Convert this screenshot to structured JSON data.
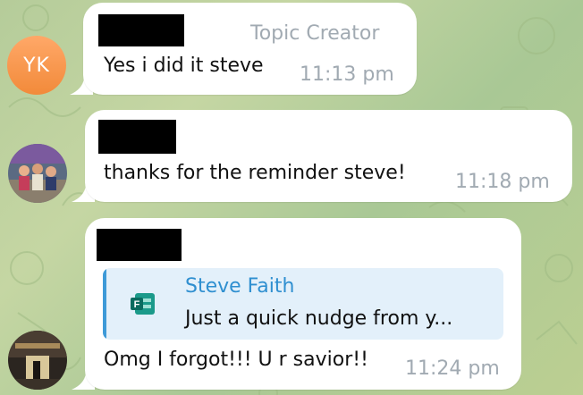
{
  "messages": [
    {
      "sender_badge": "Topic Creator",
      "text": "Yes i did it steve",
      "time": "11:13 pm",
      "avatar_initials": "YK"
    },
    {
      "text": "thanks for the reminder steve!",
      "time": "11:18 pm",
      "avatar_icon": "group-photo-avatar"
    },
    {
      "reply": {
        "name": "Steve Faith",
        "text": "Just a quick nudge from y...",
        "icon": "forms-app-icon"
      },
      "text": "Omg I forgot!!! U r savior!!",
      "time": "11:24 pm",
      "avatar_icon": "photo-avatar"
    }
  ],
  "colors": {
    "background": "#b5cc9a",
    "bubble": "#ffffff",
    "time": "#a1aab2",
    "reply_name": "#2f8fd0",
    "reply_bg": "#e3f0fa",
    "avatar_yk": "#f5913f"
  }
}
